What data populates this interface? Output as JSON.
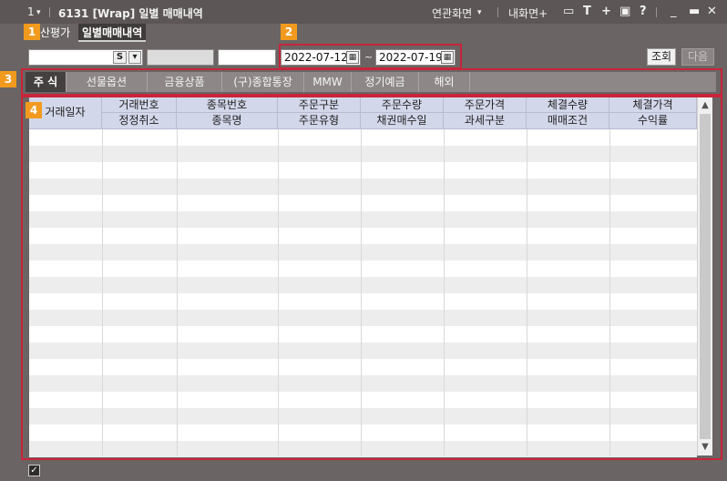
{
  "titlebar": {
    "screen_no": "1",
    "window_title": "6131 [Wrap] 일별 매매내역",
    "linked_screen": "연관화면",
    "my_screen": "내화면+",
    "icons": [
      "dropdown-icon",
      "monitor-icon",
      "font-icon",
      "plus-icon",
      "print-icon",
      "help-icon",
      "minimize-icon",
      "maximize-icon",
      "close-icon"
    ]
  },
  "top_tabs": [
    {
      "label": "산평가",
      "active": false
    },
    {
      "label": "일별매매내역",
      "active": true
    }
  ],
  "callouts": [
    "1",
    "2",
    "3",
    "4"
  ],
  "toolbar": {
    "s_label": "S",
    "date_from": "2022-07-12",
    "date_sep": "~",
    "date_to": "2022-07-19",
    "search_label": "조회",
    "next_label": "다음"
  },
  "category_tabs": [
    "주 식",
    "선물옵션",
    "금융상품",
    "(구)종합통장",
    "MMW",
    "정기예금",
    "해외"
  ],
  "columns_top": [
    "거래번호",
    "종목번호",
    "주문구분",
    "주문수량",
    "주문가격",
    "체결수량",
    "체결가격"
  ],
  "columns_bottom": [
    "정정취소",
    "종목명",
    "주문유형",
    "채권매수일",
    "과세구분",
    "매매조건",
    "수익률"
  ],
  "first_column": "거래일자",
  "colors": {
    "accent_orange": "#f19a1e",
    "highlight_red": "#c8243a",
    "header_blue": "#d3d7ea",
    "window_bg": "#6a6564"
  }
}
